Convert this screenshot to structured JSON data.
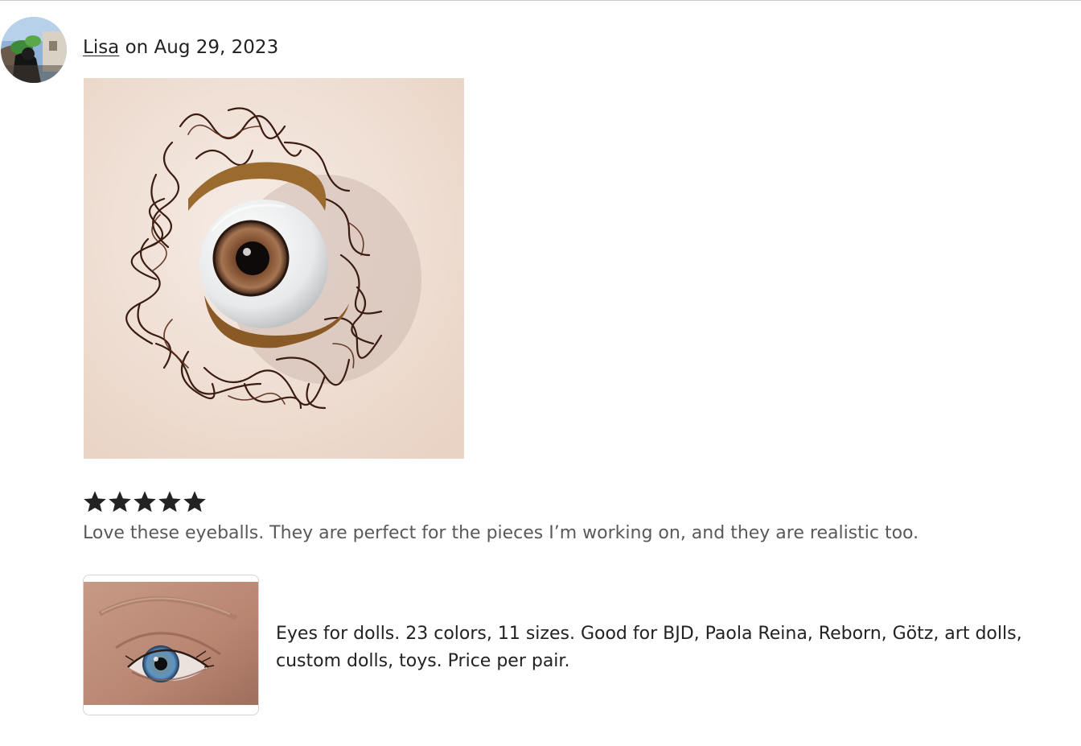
{
  "review": {
    "reviewer_name": "Lisa",
    "date_text": "on Aug 29, 2023",
    "rating": 5,
    "rating_max": 5,
    "text": "Love these eyeballs. They are perfect for the pieces I’m working on, and they are realistic too."
  },
  "product": {
    "title": "Eyes for dolls. 23 colors, 11 sizes. Good for BJD, Paola Reina, Reborn, Götz, art dolls, custom dolls, toys. Price per pair."
  },
  "icons": {
    "star": "star-icon"
  },
  "colors": {
    "text_primary": "#222222",
    "text_secondary": "#595959",
    "star": "#222222",
    "divider": "#c7c7c7"
  }
}
